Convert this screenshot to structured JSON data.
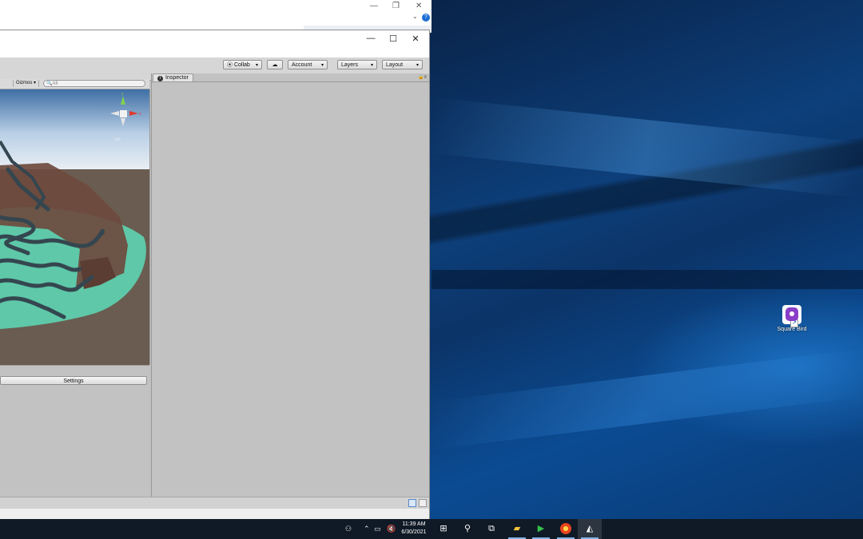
{
  "back_window": {
    "minimize_glyph": "—",
    "restore_glyph": "❐",
    "close_glyph": "✕",
    "help_glyph": "?"
  },
  "unity": {
    "titlebar": {
      "minimize_glyph": "—",
      "maximize_glyph": "☐",
      "close_glyph": "✕"
    },
    "toolbar": {
      "collab": "Collab",
      "account": "Account",
      "layers": "Layers",
      "layout": "Layout",
      "caret": "▾"
    },
    "scene": {
      "gizmos": "Gizmos",
      "search_placeholder": "All",
      "gizmo_label": "Iso"
    },
    "bottom_panel": {
      "settings": "Settings"
    },
    "inspector": {
      "tab_label": "Inspector",
      "info_glyph": "i"
    }
  },
  "desktop": {
    "icons": [
      {
        "label": "Square Bird",
        "icon": "square-bird-app-icon"
      }
    ]
  },
  "taskbar": {
    "clock_time": "11:39 AM",
    "clock_date": "6/30/2021",
    "apps": [
      "start-icon",
      "search-icon",
      "task-view-icon",
      "file-explorer-icon",
      "green-app-icon",
      "browser-icon",
      "unity-icon"
    ]
  },
  "colors": {
    "desktop_blue": "#0b4b92",
    "taskbar": "#101a26",
    "unity_panel": "#c2c2c2",
    "terrain_teal": "#5ec8a8",
    "terrain_brown": "#6e4a3e"
  }
}
